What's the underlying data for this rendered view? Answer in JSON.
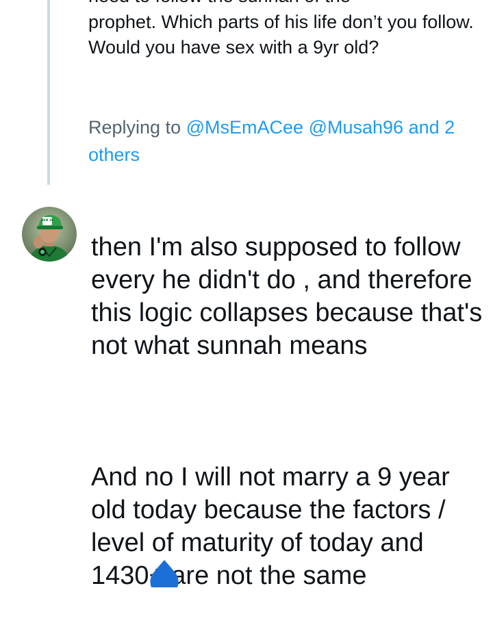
{
  "parent_tweet": {
    "text_top_cut": "need to follow the sunnah of the",
    "text": "prophet. Which parts of his life don’t you follow. Would you have sex with a 9yr old?"
  },
  "replying_to": {
    "prefix": "Replying to",
    "mention_1": "@MsEmACee",
    "mention_2": "@Musah96",
    "others": "and 2 others"
  },
  "reply_tweet": {
    "avatar_badge": "BEN 10",
    "paragraph_1": "then I'm also supposed to follow every he didn't do , and therefore this logic collapses because that's not what sunnah means",
    "paragraph_2": "And no I will not marry a 9 year old today because the factors / level of maturity of today and 1430+ are not the same"
  },
  "colors": {
    "text": "#0f1419",
    "secondary": "#536471",
    "link": "#1d9bf0",
    "thread_line": "#cfd9de",
    "drop_icon": "#1d6fd8"
  },
  "icons": {
    "floating": "water-drop-icon"
  }
}
